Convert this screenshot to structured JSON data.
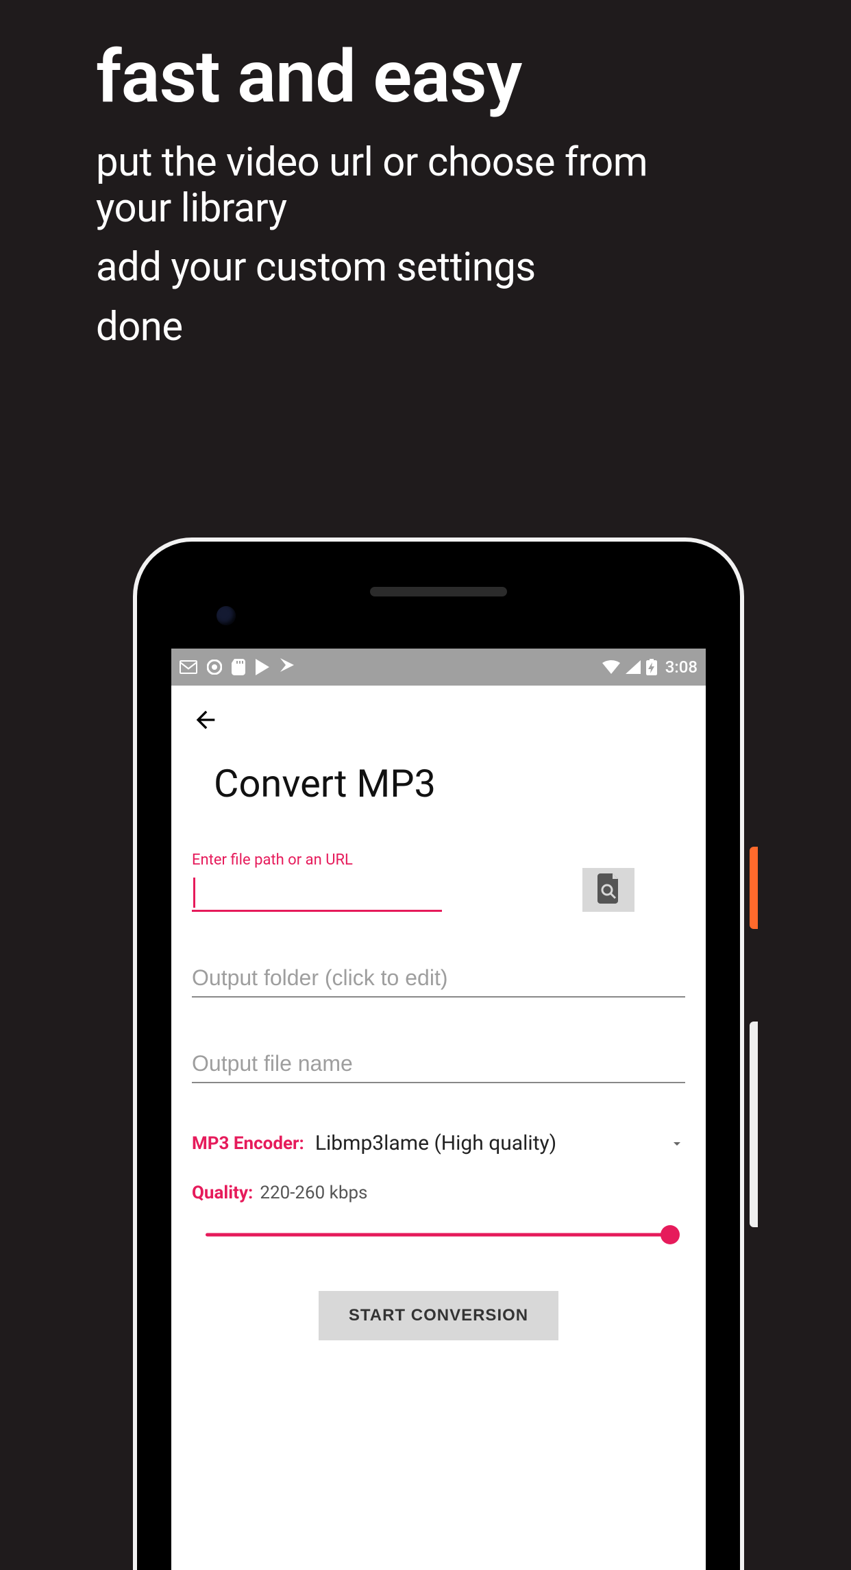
{
  "hero": {
    "title": "fast and easy",
    "line1": "put the video url or choose from your library",
    "line2": "add your custom settings",
    "line3": "done"
  },
  "status": {
    "time": "3:08"
  },
  "app": {
    "title": "Convert MP3",
    "url_label": "Enter file path or an URL",
    "url_value": "",
    "output_folder_placeholder": "Output folder (click to edit)",
    "output_name_placeholder": "Output file name",
    "encoder_label": "MP3 Encoder:",
    "encoder_value": "Libmp3lame (High quality)",
    "quality_label": "Quality:",
    "quality_value": "220-260 kbps",
    "start_label": "START CONVERSION"
  }
}
